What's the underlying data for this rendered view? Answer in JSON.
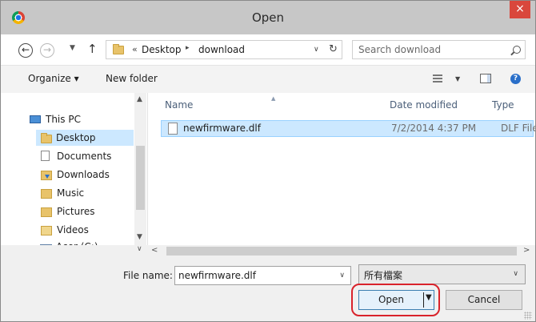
{
  "window": {
    "title": "Open",
    "close_glyph": "×"
  },
  "nav": {
    "back_glyph": "←",
    "forward_glyph": "→",
    "history_glyph": "▼",
    "up_glyph": "↑"
  },
  "address": {
    "overflow_glyph": "«",
    "crumbs": [
      "Desktop",
      "download"
    ],
    "separator_glyph": "▸",
    "dropdown_glyph": "∨",
    "refresh_glyph": "↻"
  },
  "search": {
    "placeholder": "Search download",
    "icon": "search-icon"
  },
  "toolbar": {
    "organize_label": "Organize ▾",
    "new_folder_label": "New folder",
    "views_dropdown_glyph": "▼",
    "help_glyph": "?"
  },
  "sidebar": {
    "scroll_up_glyph": "▲",
    "scroll_down_glyph": "▼",
    "scroll_right_glyph": "∨",
    "items": [
      {
        "label": "This PC",
        "icon": "pc-icon"
      },
      {
        "label": "Desktop",
        "icon": "folder-icon",
        "selected": true
      },
      {
        "label": "Documents",
        "icon": "documents-icon"
      },
      {
        "label": "Downloads",
        "icon": "downloads-icon"
      },
      {
        "label": "Music",
        "icon": "music-icon"
      },
      {
        "label": "Pictures",
        "icon": "pictures-icon"
      },
      {
        "label": "Videos",
        "icon": "videos-icon"
      },
      {
        "label": "Acer (C:)",
        "icon": "drive-icon"
      }
    ]
  },
  "columns": {
    "name": "Name",
    "date": "Date modified",
    "type": "Type",
    "sort_glyph": "▲"
  },
  "files": [
    {
      "name": "newfirmware.dlf",
      "date": "7/2/2014 4:37 PM",
      "type": "DLF File"
    }
  ],
  "hscroll": {
    "left_glyph": "<",
    "right_glyph": ">"
  },
  "footer": {
    "filename_label": "File name:",
    "filename_value": "newfirmware.dlf",
    "filename_dropdown_glyph": "∨",
    "filetype_value": "所有檔案",
    "filetype_dropdown_glyph": "∨",
    "open_label": "Open",
    "open_split_glyph": "▼",
    "cancel_label": "Cancel"
  },
  "colors": {
    "titlebar": "#c7c7c7",
    "close": "#d9473c",
    "selection": "#cce8ff",
    "highlight_ring": "#d9232b"
  }
}
